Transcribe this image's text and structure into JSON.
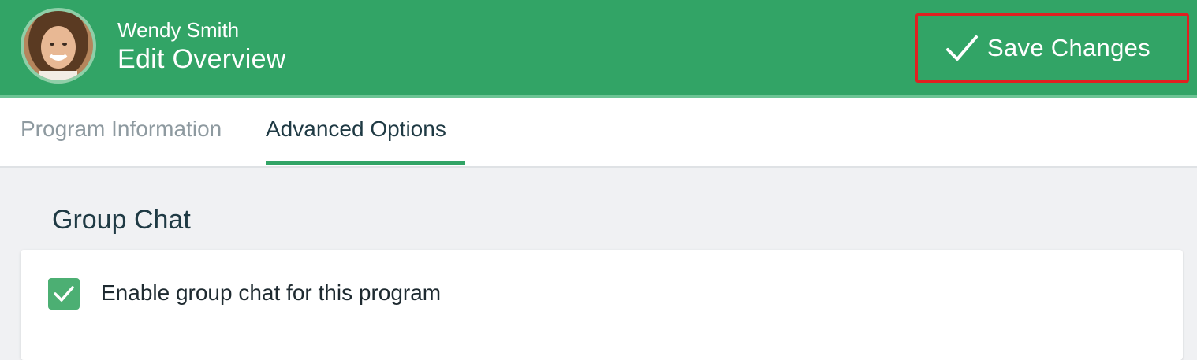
{
  "header": {
    "user_name": "Wendy Smith",
    "page_title": "Edit Overview",
    "save_label": "Save Changes",
    "bg_color": "#32a466"
  },
  "tabs": [
    {
      "label": "Program Information",
      "active": false
    },
    {
      "label": "Advanced Options",
      "active": true
    }
  ],
  "group_chat": {
    "section_title": "Group Chat",
    "checkbox_label": "Enable group chat for this program",
    "checked": true
  },
  "icons": {
    "avatar": "user-avatar",
    "save": "checkmark-icon",
    "checkbox": "checkmark-icon"
  }
}
